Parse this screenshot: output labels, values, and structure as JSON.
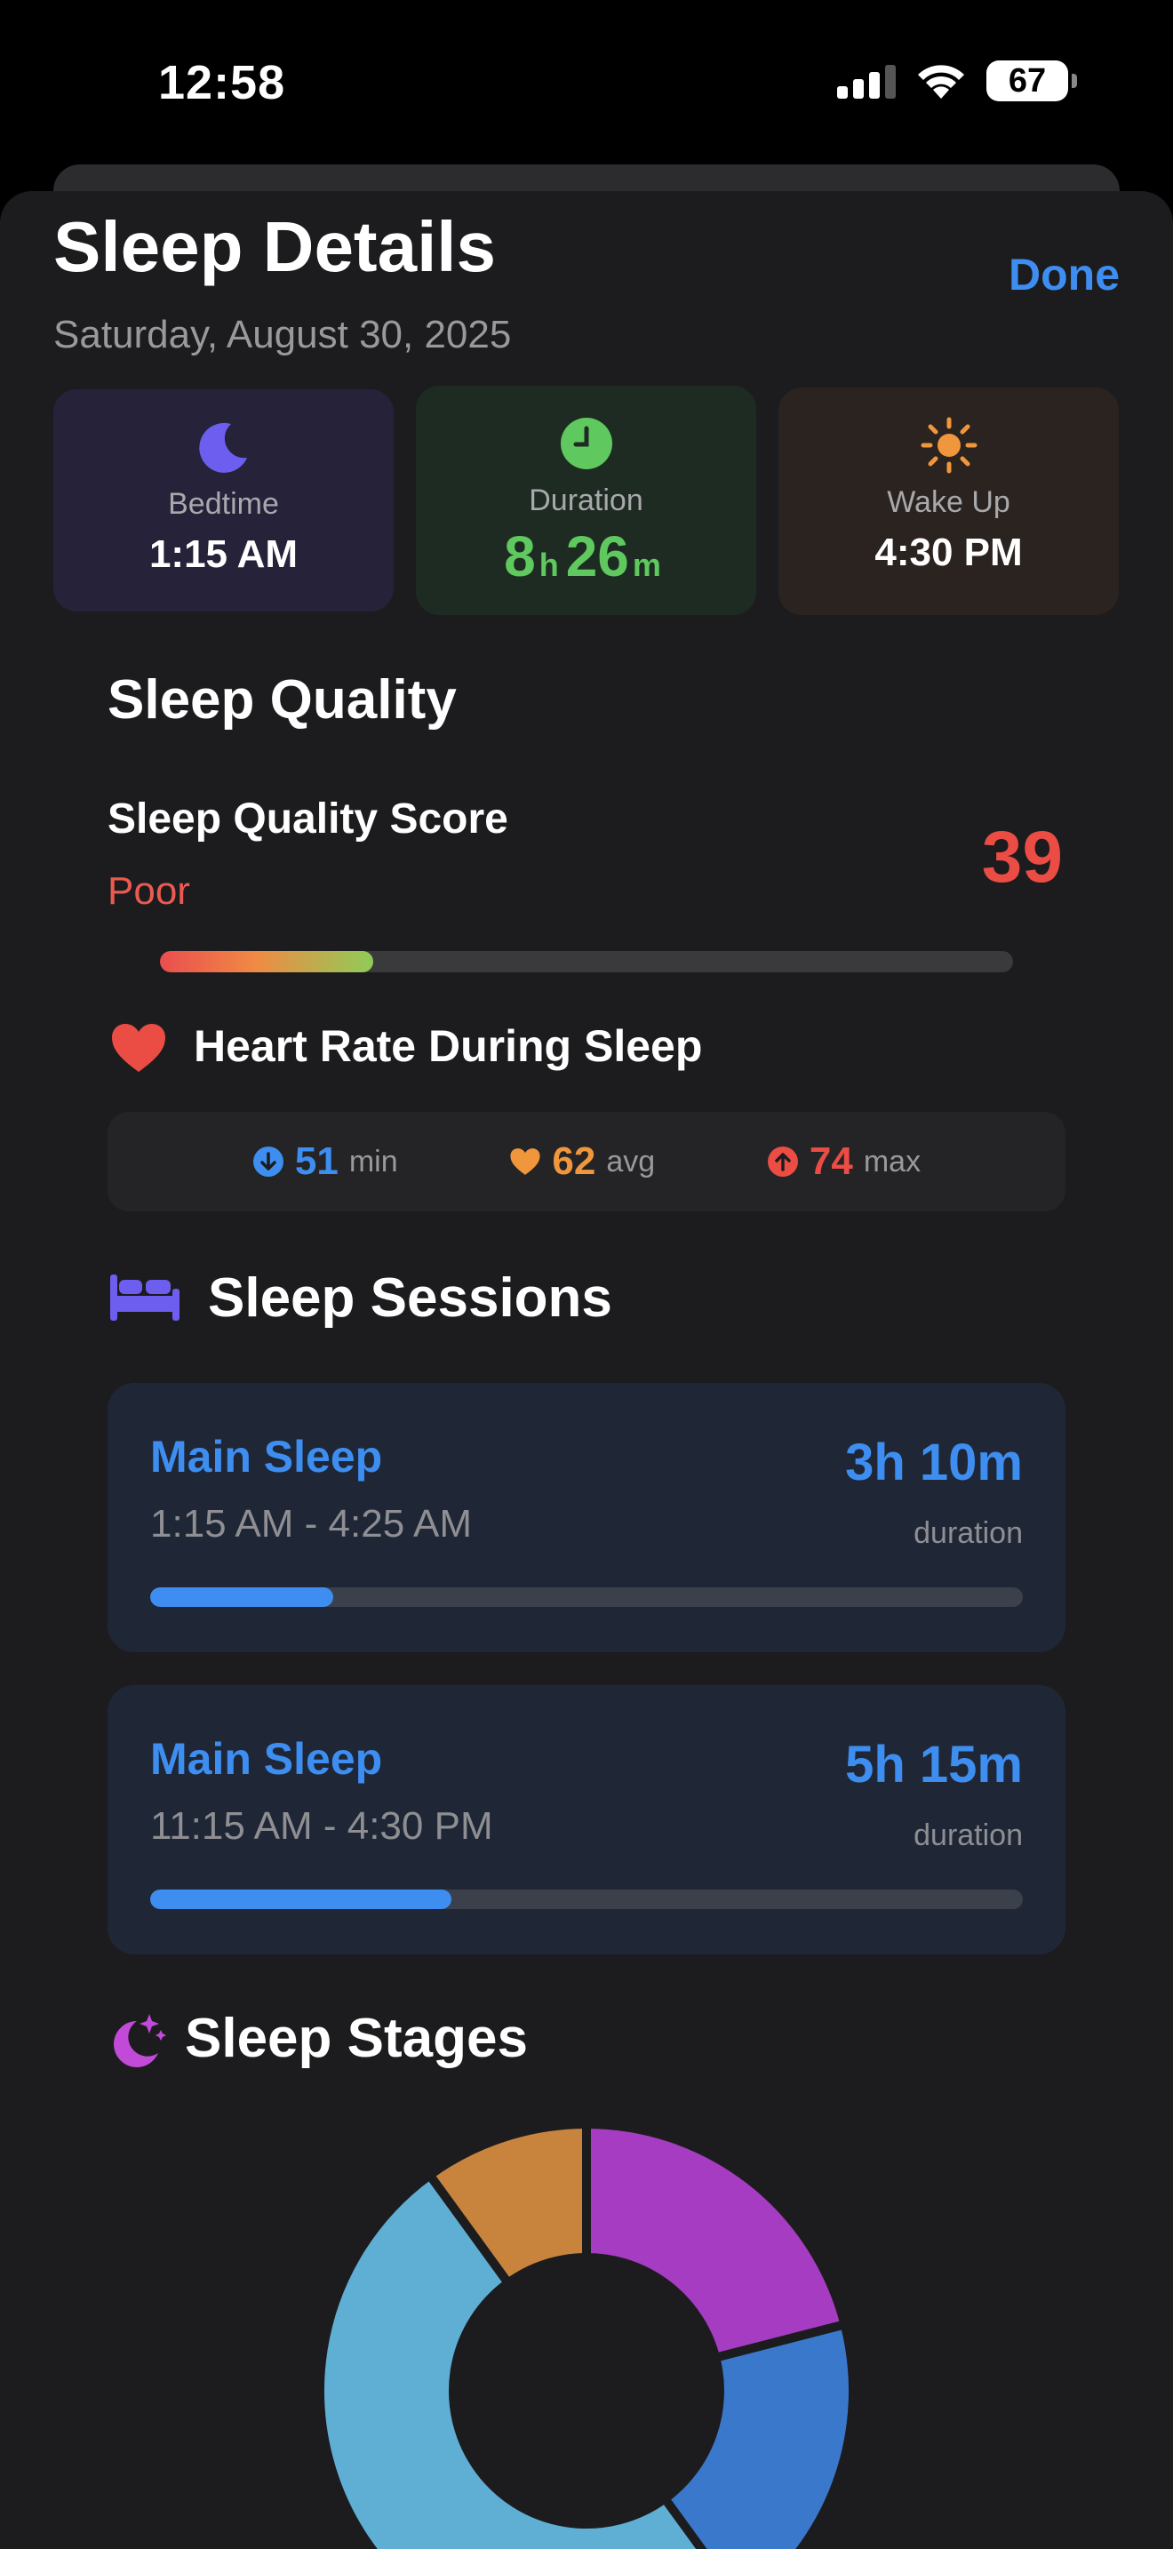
{
  "status_bar": {
    "time": "12:58",
    "battery": "67"
  },
  "header": {
    "title": "Sleep Details",
    "date": "Saturday, August 30, 2025",
    "done_label": "Done"
  },
  "summary": {
    "bedtime": {
      "label": "Bedtime",
      "value": "1:15 AM",
      "icon": "moon-icon"
    },
    "duration": {
      "label": "Duration",
      "hours": "8",
      "hours_unit": "h",
      "minutes": "26",
      "minutes_unit": "m",
      "icon": "clock-icon"
    },
    "wake_up": {
      "label": "Wake Up",
      "value": "4:30 PM",
      "icon": "sun-icon"
    }
  },
  "quality": {
    "section_title": "Sleep Quality",
    "score_label": "Sleep Quality Score",
    "rating": "Poor",
    "score": "39",
    "score_fraction": 0.25
  },
  "heart_rate": {
    "title": "Heart Rate During Sleep",
    "min": {
      "value": "51",
      "unit": "min",
      "color": "#3d8ef0"
    },
    "avg": {
      "value": "62",
      "unit": "avg",
      "color": "#f0963c"
    },
    "max": {
      "value": "74",
      "unit": "max",
      "color": "#eb4d44"
    }
  },
  "sessions": {
    "section_title": "Sleep Sessions",
    "items": [
      {
        "name": "Main Sleep",
        "range": "1:15 AM - 4:25 AM",
        "duration": "3h 10m",
        "duration_label": "duration",
        "fraction": 0.21
      },
      {
        "name": "Main Sleep",
        "range": "11:15 AM - 4:30 PM",
        "duration": "5h 15m",
        "duration_label": "duration",
        "fraction": 0.345
      }
    ]
  },
  "stages": {
    "section_title": "Sleep Stages"
  },
  "chart_data": {
    "type": "pie",
    "values": [
      21,
      19,
      50,
      10
    ],
    "colors": [
      "#a63cc2",
      "#3a78cc",
      "#5fafd4",
      "#c8843d"
    ]
  }
}
